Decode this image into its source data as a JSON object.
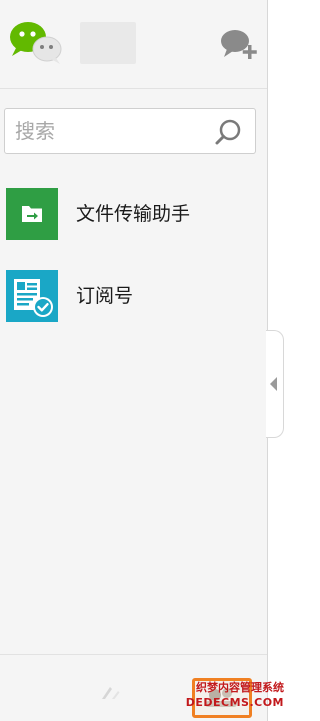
{
  "search": {
    "placeholder": "搜索"
  },
  "chats": [
    {
      "name": "文件传输助手",
      "icon": "folder-arrow-icon",
      "color": "#2f9e44"
    },
    {
      "name": "订阅号",
      "icon": "article-check-icon",
      "color": "#1aa7c6"
    }
  ],
  "watermark": {
    "line1": "织梦内容管理系统",
    "line2": "DEDECMS.COM"
  },
  "colors": {
    "wechat_green": "#62b900",
    "panel_bg": "#f5f5f5",
    "compose_gray": "#8a8a8a",
    "watermark_red": "#c2191c",
    "watermark_orange": "#f08022"
  }
}
